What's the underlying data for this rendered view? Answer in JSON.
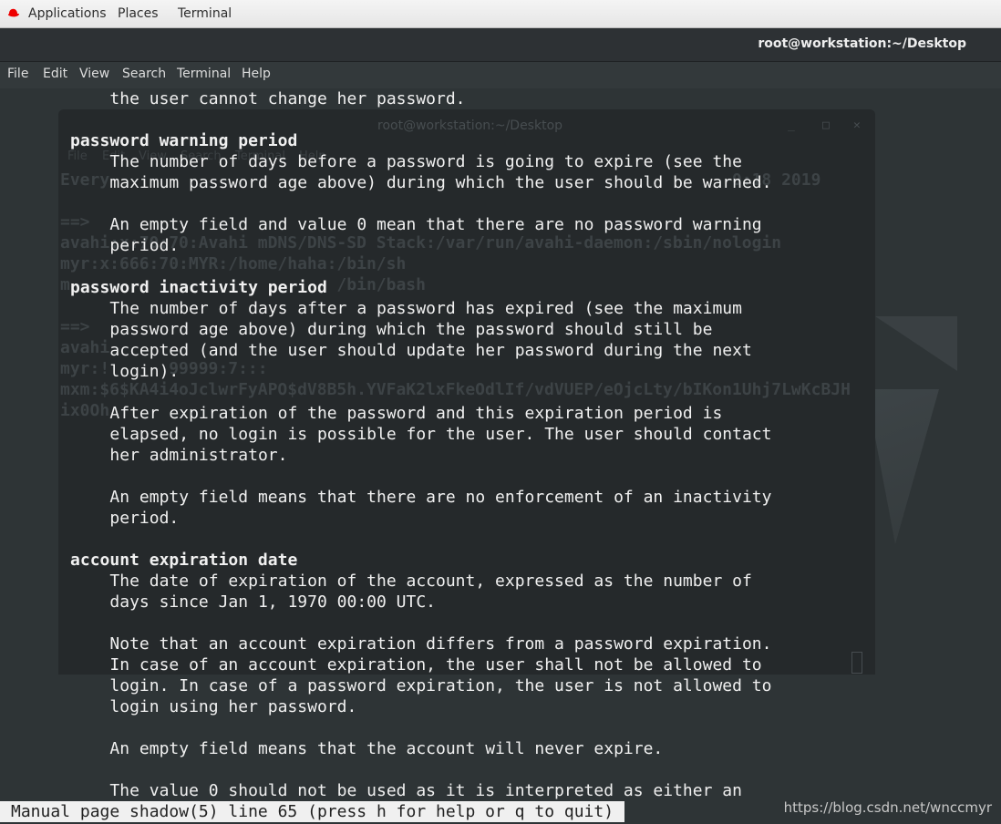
{
  "topbar": {
    "logo_icon": "redhat-hat-icon",
    "items": [
      "Applications",
      "Places",
      "Terminal"
    ]
  },
  "window": {
    "title": "root@workstation:~/Desktop"
  },
  "menubar": [
    "File",
    "Edit",
    "View",
    "Search",
    "Terminal",
    "Help"
  ],
  "background_window": {
    "title": "root@workstation:~/Desktop",
    "menu": [
      "File",
      "Edit",
      "View",
      "Search",
      "Terminal",
      "Help"
    ],
    "lines": [
      {
        "row": 4,
        "text": "Every                                                               0:18 2019"
      },
      {
        "row": 6,
        "text": "==>"
      },
      {
        "row": 7,
        "text": "avahi:x:70:70:Avahi mDNS/DNS-SD Stack:/var/run/avahi-daemon:/sbin/nologin"
      },
      {
        "row": 8,
        "text": "myr:x:666:70:MYR:/home/haha:/bin/sh"
      },
      {
        "row": 9,
        "text": "m                           /bin/bash"
      },
      {
        "row": 11,
        "text": "==>"
      },
      {
        "row": 12,
        "text": "avahi"
      },
      {
        "row": 13,
        "text": "myr:!      99999:7:::"
      },
      {
        "row": 14,
        "text": "mxm:$6$KA4i4oJclwrFyAPO$dV8B5h.YVFaK2lxFkeOdlIf/vdVUEP/eOjcLty/bIKon1Uhj7LwKcBJH"
      },
      {
        "row": 15,
        "text": "ix0Oh"
      }
    ]
  },
  "man_lines": [
    {
      "indent": 10,
      "bold": false,
      "text": "the user cannot change her password."
    },
    {
      "indent": 0,
      "bold": false,
      "text": ""
    },
    {
      "indent": 6,
      "bold": true,
      "text": "password warning period"
    },
    {
      "indent": 10,
      "bold": false,
      "text": "The number of days before a password is going to expire (see the"
    },
    {
      "indent": 10,
      "bold": false,
      "text": "maximum password age above) during which the user should be warned."
    },
    {
      "indent": 0,
      "bold": false,
      "text": ""
    },
    {
      "indent": 10,
      "bold": false,
      "text": "An empty field and value 0 mean that there are no password warning"
    },
    {
      "indent": 10,
      "bold": false,
      "text": "period."
    },
    {
      "indent": 0,
      "bold": false,
      "text": ""
    },
    {
      "indent": 6,
      "bold": true,
      "text": "password inactivity period"
    },
    {
      "indent": 10,
      "bold": false,
      "text": "The number of days after a password has expired (see the maximum"
    },
    {
      "indent": 10,
      "bold": false,
      "text": "password age above) during which the password should still be"
    },
    {
      "indent": 10,
      "bold": false,
      "text": "accepted (and the user should update her password during the next"
    },
    {
      "indent": 10,
      "bold": false,
      "text": "login)."
    },
    {
      "indent": 0,
      "bold": false,
      "text": ""
    },
    {
      "indent": 10,
      "bold": false,
      "text": "After expiration of the password and this expiration period is"
    },
    {
      "indent": 10,
      "bold": false,
      "text": "elapsed, no login is possible for the user. The user should contact"
    },
    {
      "indent": 10,
      "bold": false,
      "text": "her administrator."
    },
    {
      "indent": 0,
      "bold": false,
      "text": ""
    },
    {
      "indent": 10,
      "bold": false,
      "text": "An empty field means that there are no enforcement of an inactivity"
    },
    {
      "indent": 10,
      "bold": false,
      "text": "period."
    },
    {
      "indent": 0,
      "bold": false,
      "text": ""
    },
    {
      "indent": 6,
      "bold": true,
      "text": "account expiration date"
    },
    {
      "indent": 10,
      "bold": false,
      "text": "The date of expiration of the account, expressed as the number of"
    },
    {
      "indent": 10,
      "bold": false,
      "text": "days since Jan 1, 1970 00:00 UTC."
    },
    {
      "indent": 0,
      "bold": false,
      "text": ""
    },
    {
      "indent": 10,
      "bold": false,
      "text": "Note that an account expiration differs from a password expiration."
    },
    {
      "indent": 10,
      "bold": false,
      "text": "In case of an account expiration, the user shall not be allowed to"
    },
    {
      "indent": 10,
      "bold": false,
      "text": "login. In case of a password expiration, the user is not allowed to"
    },
    {
      "indent": 10,
      "bold": false,
      "text": "login using her password."
    },
    {
      "indent": 0,
      "bold": false,
      "text": ""
    },
    {
      "indent": 10,
      "bold": false,
      "text": "An empty field means that the account will never expire."
    },
    {
      "indent": 0,
      "bold": false,
      "text": ""
    },
    {
      "indent": 10,
      "bold": false,
      "text": "The value 0 should not be used as it is interpreted as either an"
    }
  ],
  "status_line": "Manual page shadow(5) line 65 (press h for help or q to quit)",
  "watermark": "https://blog.csdn.net/wnccmyr"
}
